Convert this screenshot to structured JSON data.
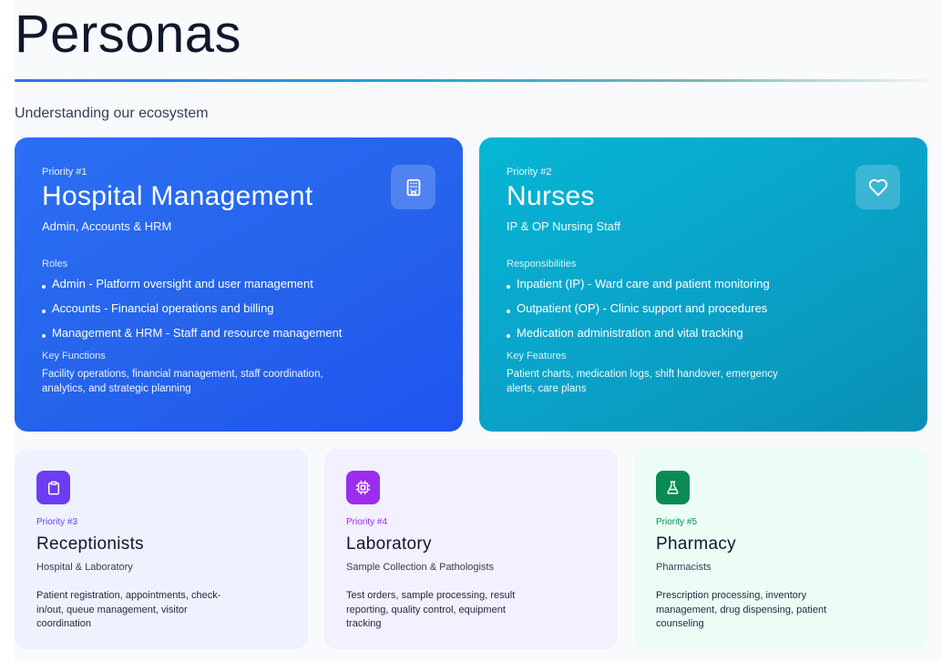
{
  "header": {
    "title": "Personas",
    "subtitle": "Understanding our ecosystem"
  },
  "cards": {
    "hospital": {
      "priority": "Priority #1",
      "name": "Hospital Management",
      "tagline": "Admin, Accounts & HRM",
      "section_label": "Roles",
      "items": [
        "Admin - Platform oversight and user management",
        "Accounts - Financial operations and billing",
        "Management & HRM - Staff and resource management"
      ],
      "key_label": "Key Functions",
      "key_text": "Facility operations, financial management, staff coordination, analytics, and strategic planning",
      "icon": "building-icon"
    },
    "nurses": {
      "priority": "Priority #2",
      "name": "Nurses",
      "tagline": "IP & OP Nursing Staff",
      "section_label": "Responsibilities",
      "items": [
        "Inpatient (IP) - Ward care and patient monitoring",
        "Outpatient (OP) - Clinic support and procedures",
        "Medication administration and vital tracking"
      ],
      "key_label": "Key Features",
      "key_text": "Patient charts, medication logs, shift handover, emergency alerts, care plans",
      "icon": "heart-icon"
    },
    "receptionists": {
      "priority": "Priority #3",
      "name": "Receptionists",
      "tagline": "Hospital & Laboratory",
      "description": "Patient registration, appointments, check-in/out, queue management, visitor coordination",
      "icon": "clipboard-icon",
      "accent": "#6d3cf5"
    },
    "laboratory": {
      "priority": "Priority #4",
      "name": "Laboratory",
      "tagline": "Sample Collection & Pathologists",
      "description": "Test orders, sample processing, result reporting, quality control, equipment tracking",
      "icon": "chip-icon",
      "accent": "#9b2cf0"
    },
    "pharmacy": {
      "priority": "Priority #5",
      "name": "Pharmacy",
      "tagline": "Pharmacists",
      "description": "Prescription processing, inventory management, drug dispensing, patient counseling",
      "icon": "flask-icon",
      "accent": "#0a8a55"
    }
  },
  "colors": {
    "hospital_bg": "#2563eb",
    "nurses_bg": "#0aa3c9",
    "receptionists_prio": "#6d3cf5",
    "laboratory_prio": "#9b2cf0",
    "pharmacy_prio": "#0a8a55"
  }
}
